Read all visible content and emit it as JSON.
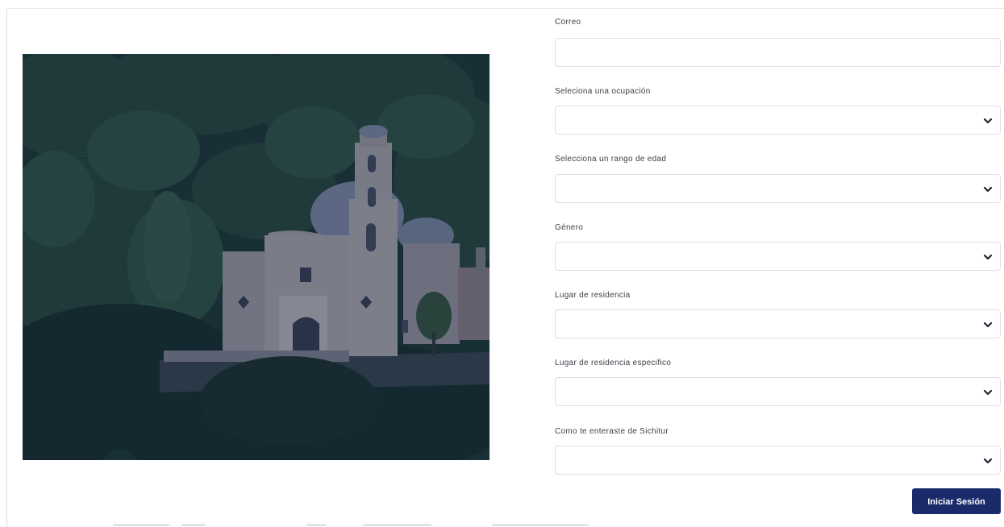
{
  "photo": {
    "icon": "church-landscape-photo",
    "overlay_color": "#0e1c4a"
  },
  "form": {
    "fields": [
      {
        "label": "Correo",
        "type": "text",
        "value": ""
      },
      {
        "label": "Seleciona una ocupación",
        "type": "select",
        "value": ""
      },
      {
        "label": "Selecciona un rango de edad",
        "type": "select",
        "value": ""
      },
      {
        "label": "Género",
        "type": "select",
        "value": ""
      },
      {
        "label": "Lugar de residencia",
        "type": "select",
        "value": ""
      },
      {
        "label": "Lugar de residencia especifico",
        "type": "select",
        "value": ""
      },
      {
        "label": "Como te enteraste de Sichitur",
        "type": "select",
        "value": ""
      }
    ],
    "submit_label": "Iniciar Sesión",
    "submit_color": "#1a2a6b",
    "chevron_icon": "chevron-down-icon"
  }
}
